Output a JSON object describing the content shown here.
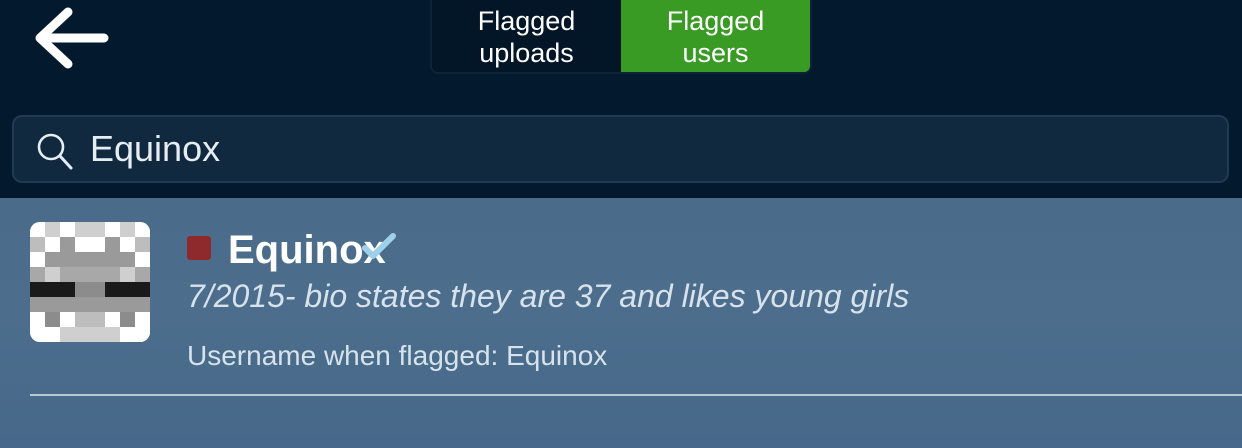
{
  "header": {
    "tabs": [
      {
        "line1": "Flagged",
        "line2": "uploads",
        "active": false
      },
      {
        "line1": "Flagged",
        "line2": "users",
        "active": true
      }
    ],
    "accent_color": "#3a9b24",
    "background_color": "#03192d"
  },
  "search": {
    "value": "Equinox",
    "icon": "search-icon"
  },
  "results": [
    {
      "username": "Equinox",
      "status_color": "#8f2a2c",
      "badge_icon": "verified-check-icon",
      "note": "7/2015- bio states they are 37 and likes young girls",
      "flagged_label": "Username when flagged:",
      "flagged_username": "Equinox"
    }
  ]
}
